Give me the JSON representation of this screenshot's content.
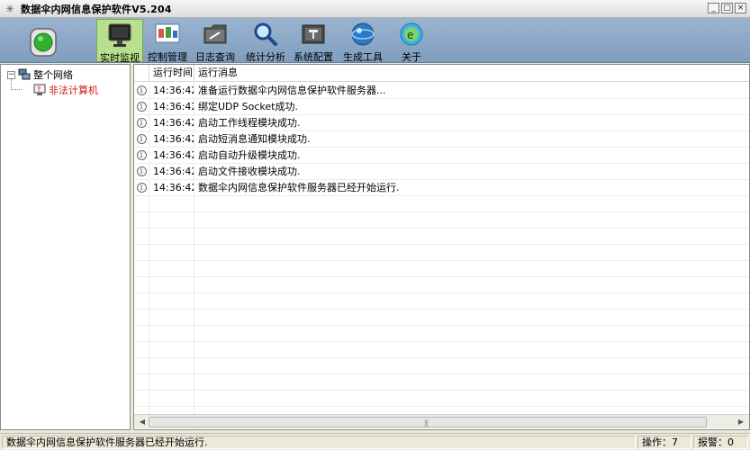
{
  "window": {
    "title": "数据伞内网信息保护软件V5.204",
    "controls": [
      "minimize",
      "restore",
      "close"
    ]
  },
  "toolbar": {
    "items": [
      {
        "label": "实时监视",
        "icon": "monitor-icon",
        "active": true
      },
      {
        "label": "控制管理",
        "icon": "control-manage-icon",
        "active": false
      },
      {
        "label": "日志查询",
        "icon": "log-query-icon",
        "active": false
      },
      {
        "label": "统计分析",
        "icon": "magnifier-icon",
        "active": false
      },
      {
        "label": "系统配置",
        "icon": "system-config-icon",
        "active": false
      },
      {
        "label": "生成工具",
        "icon": "generate-tool-icon",
        "active": false
      },
      {
        "label": "关于",
        "icon": "about-icon",
        "active": false
      }
    ]
  },
  "tree": {
    "root": {
      "label": "整个网络",
      "expander": "⊟"
    },
    "children": [
      {
        "label": "非法计算机",
        "color": "#d01818"
      }
    ]
  },
  "log": {
    "columns": [
      "运行时间",
      "运行消息"
    ],
    "rows": [
      {
        "time": "14:36:42",
        "message": "准备运行数据伞内网信息保护软件服务器..."
      },
      {
        "time": "14:36:42",
        "message": "绑定UDP Socket成功."
      },
      {
        "time": "14:36:42",
        "message": "启动工作线程模块成功."
      },
      {
        "time": "14:36:42",
        "message": "启动短消息通知模块成功."
      },
      {
        "time": "14:36:42",
        "message": "启动自动升级模块成功."
      },
      {
        "time": "14:36:42",
        "message": "启动文件接收模块成功."
      },
      {
        "time": "14:36:42",
        "message": "数据伞内网信息保护软件服务器已经开始运行."
      }
    ]
  },
  "statusbar": {
    "message": "数据伞内网信息保护软件服务器已经开始运行.",
    "operations": "操作：7",
    "alarms": "报警：0"
  },
  "colors": {
    "toolbar_bg": "#8aa6c6",
    "active_tab": "#b8e08c",
    "illegal_node": "#d01818"
  }
}
